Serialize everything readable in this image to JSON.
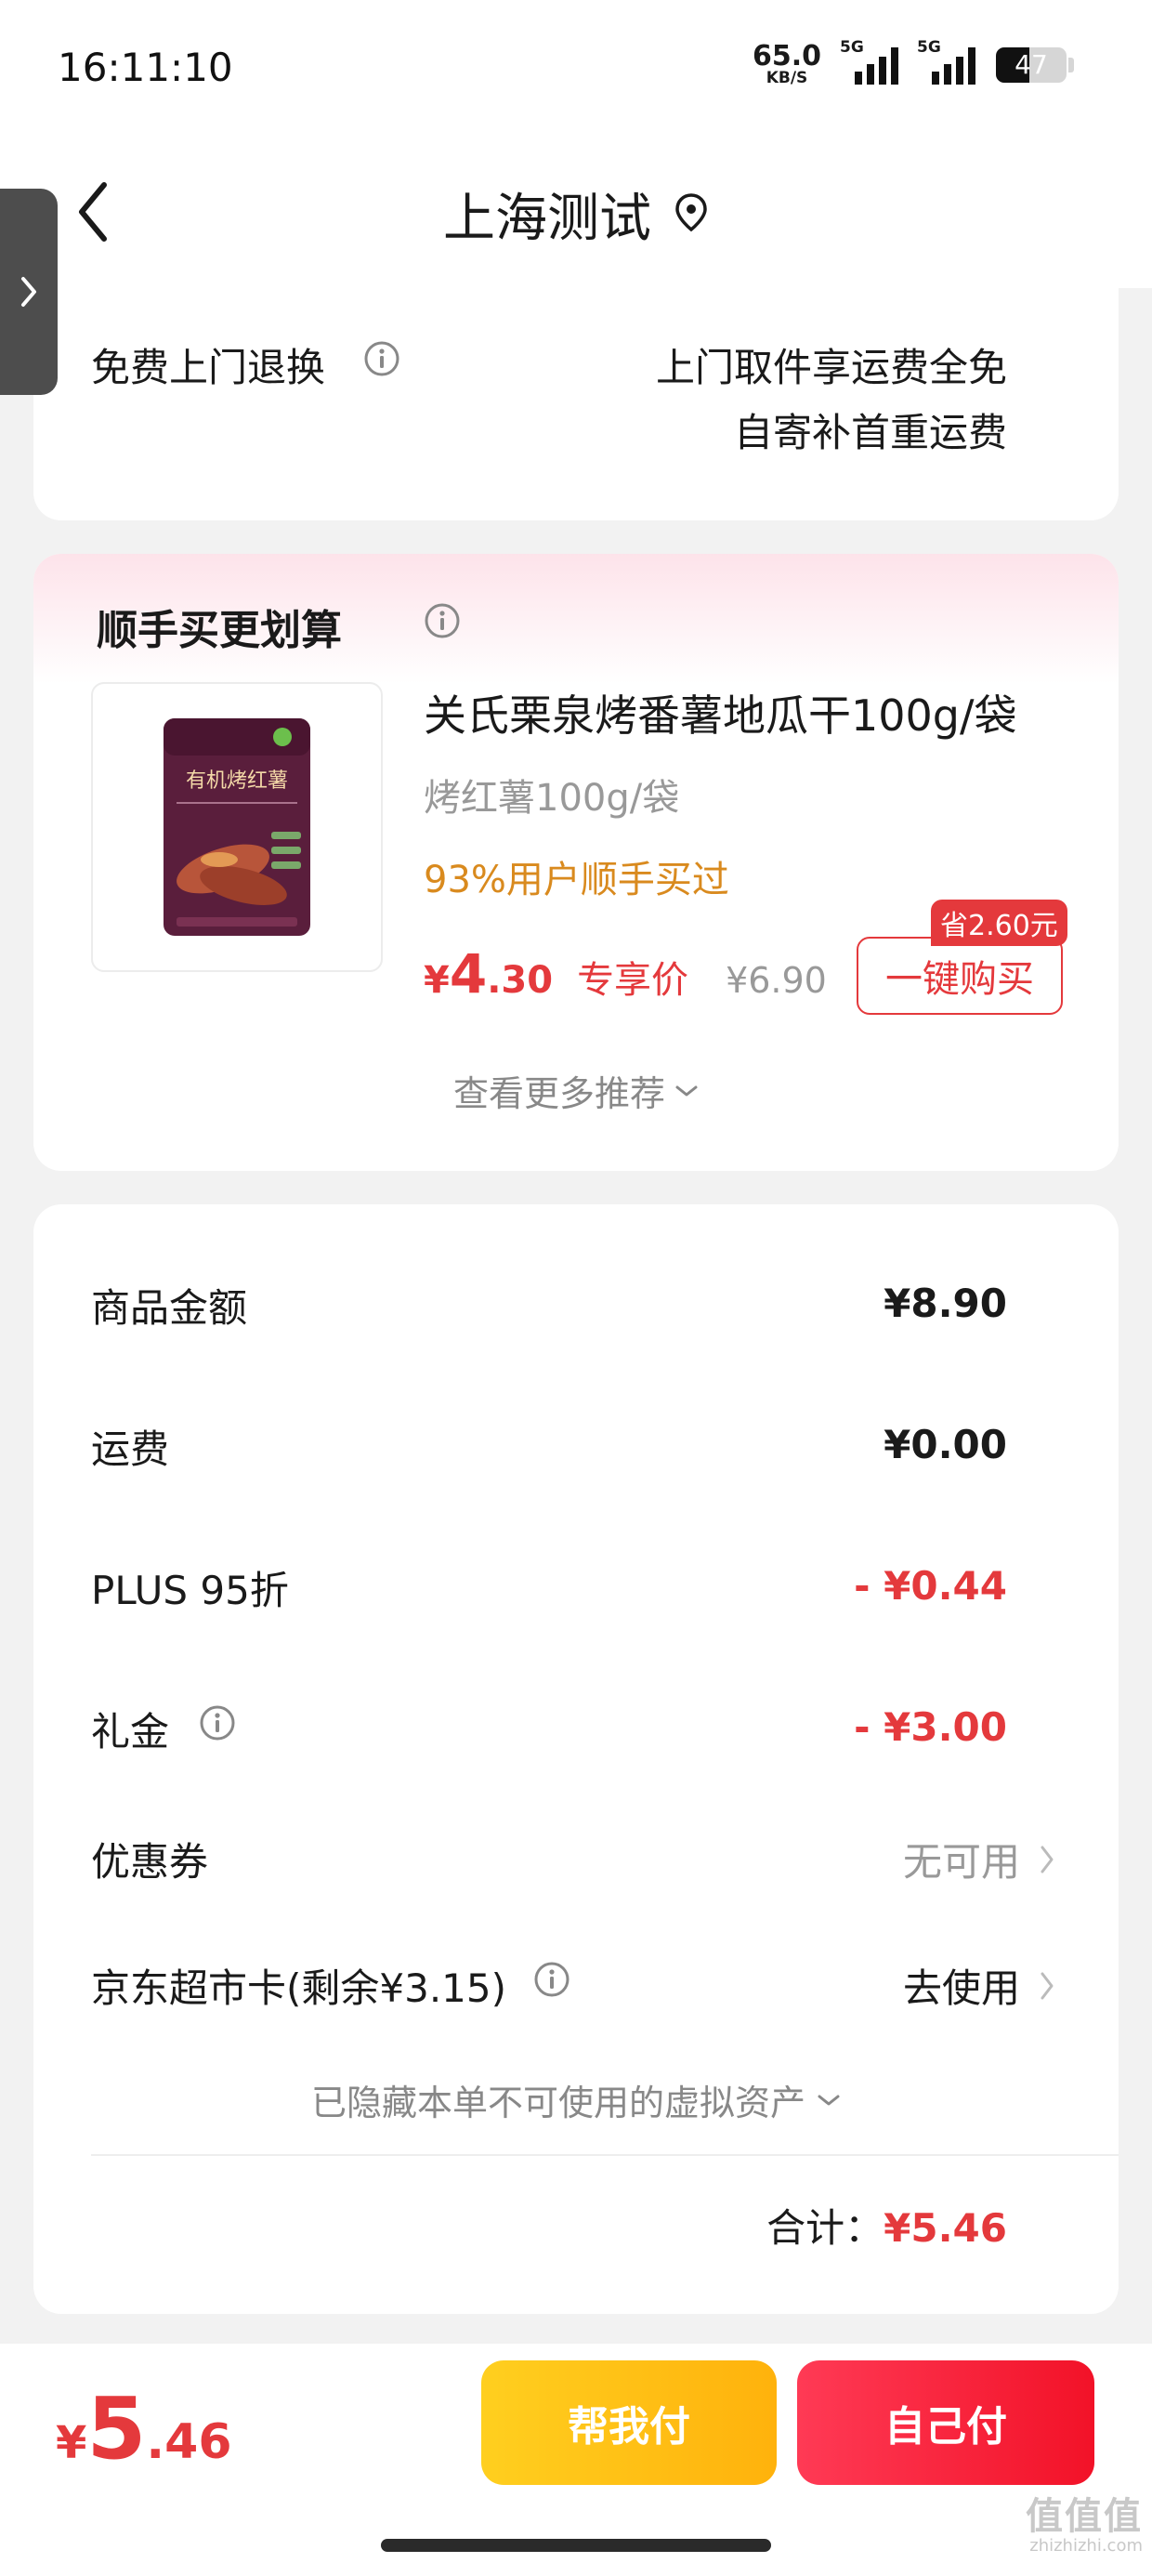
{
  "status_bar": {
    "time": "16:11:10",
    "net_speed": "65.0",
    "net_unit": "KB/S",
    "sig1_tag": "5G",
    "sig2_tag": "5G",
    "battery": "47"
  },
  "nav": {
    "title": "上海测试"
  },
  "return_section": {
    "label": "免费上门退换",
    "line1": "上门取件享运费全免",
    "line2": "自寄补首重运费"
  },
  "recommend": {
    "title": "顺手买更划算",
    "product": {
      "name": "关氏栗泉烤番薯地瓜干100g/袋",
      "spec": "烤红薯100g/袋",
      "social_proof": "93%用户顺手买过",
      "price_symbol": "¥",
      "price_int": "4",
      "price_dec": ".30",
      "price_tag": "专享价",
      "original_price": "¥6.90",
      "buy_label": "一键购买",
      "save_badge": "省2.60元",
      "package_text": "有机烤红薯"
    },
    "more_label": "查看更多推荐"
  },
  "price_summary": {
    "goods_label": "商品金额",
    "goods_value": "¥8.90",
    "shipping_label": "运费",
    "shipping_value": "¥0.00",
    "plus_label": "PLUS 95折",
    "plus_value": "- ¥0.44",
    "gift_label": "礼金",
    "gift_value": "- ¥3.00",
    "coupon_label": "优惠券",
    "coupon_value": "无可用",
    "card_label": "京东超市卡(剩余¥3.15)",
    "card_value": "去使用",
    "hidden_assets": "已隐藏本单不可使用的虚拟资产",
    "total_label": "合计：",
    "total_value": "¥5.46"
  },
  "bottom": {
    "yen": "¥",
    "price_int": "5",
    "price_dec": ".46",
    "help_pay": "帮我付",
    "self_pay": "自己付"
  },
  "watermark": {
    "main": "值值值",
    "sub": "zhizhizhi.com"
  },
  "colors": {
    "accent_red": "#e4393c",
    "gold": "#ffb20c",
    "social_orange": "#d98a1e"
  }
}
